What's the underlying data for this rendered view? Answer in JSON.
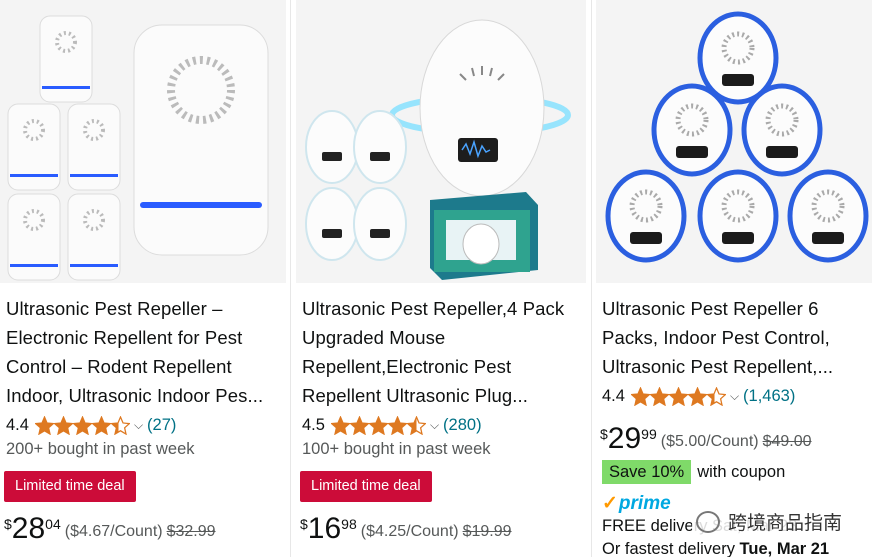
{
  "products": [
    {
      "title_lines": [
        "Ultrasonic Pest Repeller –",
        "Electronic Repellent for Pest",
        "Control – Rodent Repellent",
        "Indoor, Ultrasonic Indoor Pes..."
      ],
      "rating": "4.4",
      "stars": 4.4,
      "review_count": "(27)",
      "bought": "200+ bought in past week",
      "deal_label": "Limited time deal",
      "price_symbol": "$",
      "price_whole": "28",
      "price_fraction": "04",
      "unit_price": "($4.67/Count)",
      "list_price": "$32.99"
    },
    {
      "title_lines": [
        "Ultrasonic Pest Repeller,4 Pack",
        "Upgraded Mouse",
        "Repellent,Electronic Pest",
        "Repellent Ultrasonic Plug..."
      ],
      "rating": "4.5",
      "stars": 4.5,
      "review_count": "(280)",
      "bought": "100+ bought in past week",
      "deal_label": "Limited time deal",
      "price_symbol": "$",
      "price_whole": "16",
      "price_fraction": "98",
      "unit_price": "($4.25/Count)",
      "list_price": "$19.99"
    },
    {
      "title_lines": [
        "Ultrasonic Pest Repeller 6",
        "Packs, Indoor Pest Control,",
        "Ultrasonic Pest Repellent,..."
      ],
      "rating": "4.4",
      "stars": 4.4,
      "review_count": "(1,463)",
      "price_symbol": "$",
      "price_whole": "29",
      "price_fraction": "99",
      "unit_price": "($5.00/Count)",
      "list_price": "$49.00",
      "save_badge": "Save 10%",
      "save_suffix": "with coupon",
      "prime_label": "prime",
      "delivery_free": "FREE delivery Sat, Mar 23",
      "delivery_fast_prefix": "Or fastest delivery ",
      "delivery_fast_date": "Tue, Mar 21"
    }
  ],
  "watermark_text": "跨境商品指南",
  "colors": {
    "star": "#de7921",
    "link": "#007185",
    "deal": "#cc0c39",
    "save": "#7fda69",
    "prime": "#00a8e1"
  }
}
